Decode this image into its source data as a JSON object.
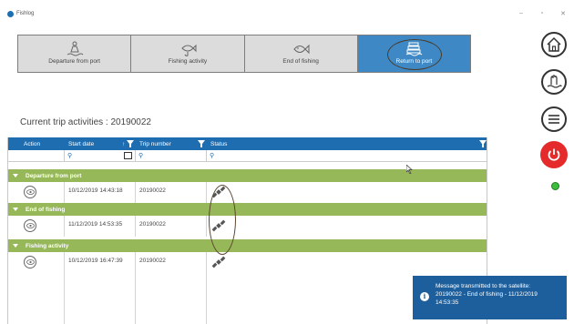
{
  "window": {
    "title": "Fishlog",
    "controls": {
      "minimize": "–",
      "maximize": "▫",
      "close": "✕"
    }
  },
  "steps": [
    {
      "label": "Departure from port",
      "icon": "person-wave-icon",
      "active": false
    },
    {
      "label": "Fishing activity",
      "icon": "fish-hook-icon",
      "active": false
    },
    {
      "label": "End of fishing",
      "icon": "fish-icon",
      "active": false
    },
    {
      "label": "Return to port",
      "icon": "cargo-stack-icon",
      "active": true
    }
  ],
  "side_buttons": [
    "home-icon",
    "boat-hand-icon",
    "menu-icon",
    "power-icon"
  ],
  "status_indicator": {
    "color": "#3cbd3c"
  },
  "page": {
    "title": "Current trip activities : 20190022"
  },
  "table": {
    "columns": {
      "action": "Action",
      "start_date": "Start date",
      "trip_number": "Trip number",
      "status": "Status"
    },
    "sort_indicator": "↑",
    "groups": [
      {
        "name": "Departure from port",
        "rows": [
          {
            "start_date": "10/12/2019 14:43:18",
            "trip_number": "20190022",
            "status_icon": "satellite-icon"
          }
        ]
      },
      {
        "name": "End of fishing",
        "rows": [
          {
            "start_date": "11/12/2019 14:53:35",
            "trip_number": "20190022",
            "status_icon": "satellite-icon"
          }
        ]
      },
      {
        "name": "Fishing activity",
        "rows": [
          {
            "start_date": "10/12/2019 16:47:39",
            "trip_number": "20190022",
            "status_icon": "satellite-icon"
          }
        ]
      }
    ]
  },
  "toast": {
    "line1": "Message transmitted to the satellite:",
    "line2": "20190022 - End of fishing - 11/12/2019",
    "line3": "14:53:35",
    "icon": "i"
  },
  "colors": {
    "accent": "#1e6db0",
    "group": "#96b858",
    "active_step": "#3e89c5",
    "power": "#e42a2a"
  }
}
